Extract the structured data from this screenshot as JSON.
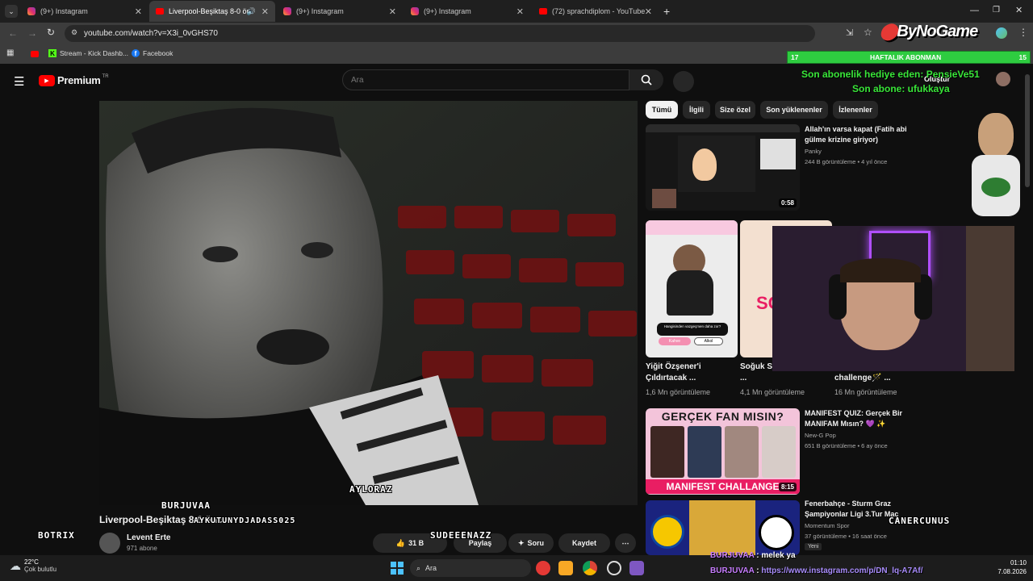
{
  "browser": {
    "tabs": [
      {
        "label": "(9+) Instagram",
        "kind": "instagram"
      },
      {
        "label": "Liverpool-Beşiktaş 8-0 önce",
        "kind": "youtube",
        "active": true
      },
      {
        "label": "(9+) Instagram",
        "kind": "instagram"
      },
      {
        "label": "(9+) Instagram",
        "kind": "instagram"
      },
      {
        "label": "(72) sprachdiplom - YouTube",
        "kind": "youtube"
      }
    ],
    "url": "youtube.com/watch?v=X3i_0vGHS70",
    "bookmarks": [
      {
        "label": "Stream - Kick Dashb..."
      },
      {
        "label": "Facebook"
      }
    ],
    "overlay_logo": "ByNoGame"
  },
  "youtube": {
    "logo_text": "Premium",
    "region": "TR",
    "search_placeholder": "Ara",
    "create_label": "Oluştur",
    "chips": [
      "Tümü",
      "İlgili",
      "Size özel",
      "Son yüklenenler",
      "İzlenenler"
    ],
    "video": {
      "title": "Liverpool-Beşiktaş 8-0 önce",
      "title_overlay": "AYKUTUNYDJADASS025",
      "watermark": "AYLORAZ",
      "channel": "Levent Erte",
      "subscribers": "971 abone",
      "likes": "31 B",
      "actions": [
        "Paylaş",
        "Soru",
        "Kaydet"
      ]
    },
    "recommendations": [
      {
        "title": "Allah'ın varsa kapat (Fatih abi gülme krizine giriyor)",
        "channel": "Panky",
        "meta": "244 B görüntüleme • 4 yıl önce",
        "duration": "0:58"
      },
      {
        "title": "MANIFEST QUIZ: Gerçek Bir MANIFAM Mısın? 💜 ✨",
        "channel": "New-G Pop",
        "meta": "651 B görüntüleme • 6 ay önce",
        "duration": "8:15",
        "thumb_text_top": "GERÇEK FAN MISIN?",
        "thumb_text_bottom": "MANIFEST CHALLANGE"
      },
      {
        "title": "Fenerbahçe - Sturm Graz Şampiyonlar Ligi 3.Tur Maç",
        "channel": "Momentum Spor",
        "meta": "37 görüntüleme • 16 saat önce",
        "badge": "Yeni"
      }
    ],
    "shorts": [
      {
        "title": "Yiğit Özşener'i Çıldırtacak ...",
        "views": "1,6 Mn görüntüleme",
        "q1": "Hangisinden vazgeçmen daha zor?",
        "opt1": "Kahve",
        "opt2": "Alkol"
      },
      {
        "title": "Soğuk S... Lidya 💗 😝 ...",
        "views": "4,1 Mn görüntüleme"
      },
      {
        "title": "challenge🪄 ...",
        "views": "16 Mn görüntüleme"
      }
    ]
  },
  "stream_overlay": {
    "goal_left": "17",
    "goal_label": "HAFTALIK ABONMAN",
    "goal_right": "15",
    "last_gift": "Son abonelik hediye eden: PensieVe51",
    "last_sub": "Son abone: ufukkaya",
    "names": [
      "BURJUVAA",
      "BOTRIX",
      "SUDEEENAZZ",
      "CANERCUNUS"
    ],
    "chat": [
      {
        "user": "BURJUVAA",
        "text": "melek ya"
      },
      {
        "user": "BURJUVAA",
        "text": "https://www.instagram.com/p/DN_lq-A7Af/"
      }
    ]
  },
  "taskbar": {
    "weather_temp": "22°C",
    "weather_desc": "Çok bulutlu",
    "search": "Ara",
    "time": "01:10",
    "date": "7.08.2026"
  },
  "colors": {
    "yt_red": "#ff0000",
    "goal_green": "#2ecc40",
    "overlay_text_green": "#39e639"
  }
}
